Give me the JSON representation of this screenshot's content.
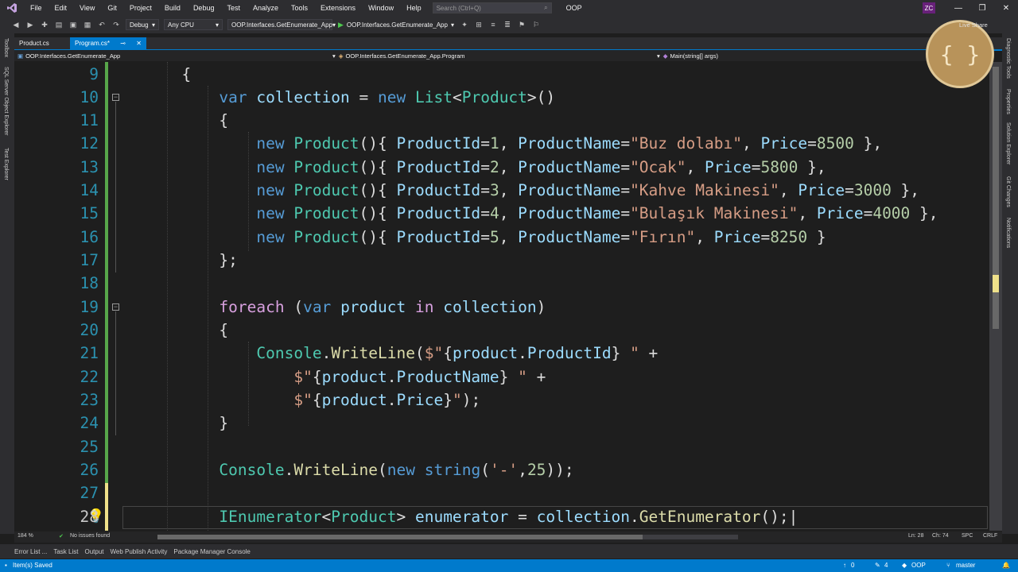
{
  "menubar": {
    "items": [
      "File",
      "Edit",
      "View",
      "Git",
      "Project",
      "Build",
      "Debug",
      "Test",
      "Analyze",
      "Tools",
      "Extensions",
      "Window",
      "Help"
    ],
    "search_placeholder": "Search (Ctrl+Q)",
    "solution_name": "OOP",
    "user_initials": "ZC",
    "live_share": "Live Share"
  },
  "toolbar": {
    "config": "Debug",
    "platform": "Any CPU",
    "startup_project": "OOP.Interfaces.GetEnumerate_App",
    "run_label": "OOP.Interfaces.GetEnumerate_App"
  },
  "left_strip": [
    "Toolbox",
    "SQL Server Object Explorer",
    "Test Explorer"
  ],
  "right_strip": [
    "Diagnostic Tools",
    "Properties",
    "Solution Explorer",
    "Git Changes",
    "Notifications"
  ],
  "tabs": [
    {
      "label": "Product.cs"
    },
    {
      "label": "Program.cs*"
    }
  ],
  "navbar": {
    "project": "OOP.Interfaces.GetEnumerate_App",
    "class": "OOP.Interfaces.GetEnumerate_App.Program",
    "member": "Main(string[] args)"
  },
  "editor": {
    "line_numbers": [
      "9",
      "10",
      "11",
      "12",
      "13",
      "14",
      "15",
      "16",
      "17",
      "18",
      "19",
      "20",
      "21",
      "22",
      "23",
      "24",
      "25",
      "26",
      "27",
      "28"
    ],
    "products": [
      {
        "id": "1",
        "name": "\"Buz dolabı\"",
        "price": "8500"
      },
      {
        "id": "2",
        "name": "\"Ocak\"",
        "price": "5800"
      },
      {
        "id": "3",
        "name": "\"Kahve Makinesi\"",
        "price": "3000"
      },
      {
        "id": "4",
        "name": "\"Bulaşık Makinesi\"",
        "price": "4000"
      },
      {
        "id": "5",
        "name": "\"Fırın\"",
        "price": "8250"
      }
    ]
  },
  "statusrow": {
    "zoom": "184 %",
    "issues": "No issues found",
    "line": "Ln: 28",
    "col": "Ch: 74",
    "spc": "SPC",
    "crlf": "CRLF"
  },
  "bottom_tabs": [
    "Error List ...",
    "Task List",
    "Output",
    "Web Publish Activity",
    "Package Manager Console"
  ],
  "statusbar": {
    "message": "Item(s) Saved",
    "up_count": "0",
    "pencil_count": "4",
    "repo": "OOP",
    "branch": "master"
  }
}
